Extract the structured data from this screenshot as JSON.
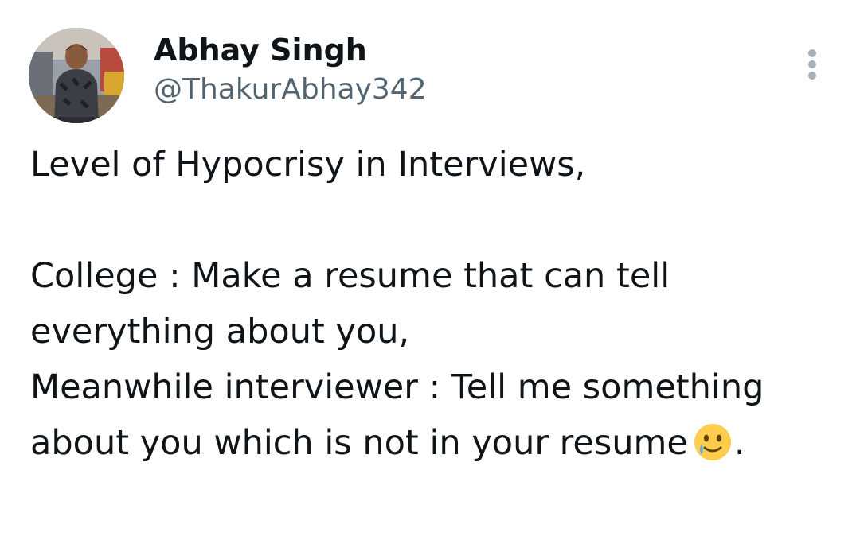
{
  "author": {
    "display_name": "Abhay Singh",
    "handle": "@ThakurAbhay342"
  },
  "more_icon": "more-vertical-icon",
  "tweet": {
    "line1": "Level of Hypocrisy in Interviews,",
    "line2_prefix": "College : Make a resume that can tell everything about you,",
    "line3": "Meanwhile interviewer : Tell me something about you which is not in your resume",
    "emoji": "smiling-face-with-tear-icon",
    "trailing": "."
  },
  "colors": {
    "text": "#0f1419",
    "secondary": "#536471",
    "more_dots": "#a7b1ba",
    "emoji_face": "#ffcc4d",
    "emoji_tear": "#5dadec"
  }
}
